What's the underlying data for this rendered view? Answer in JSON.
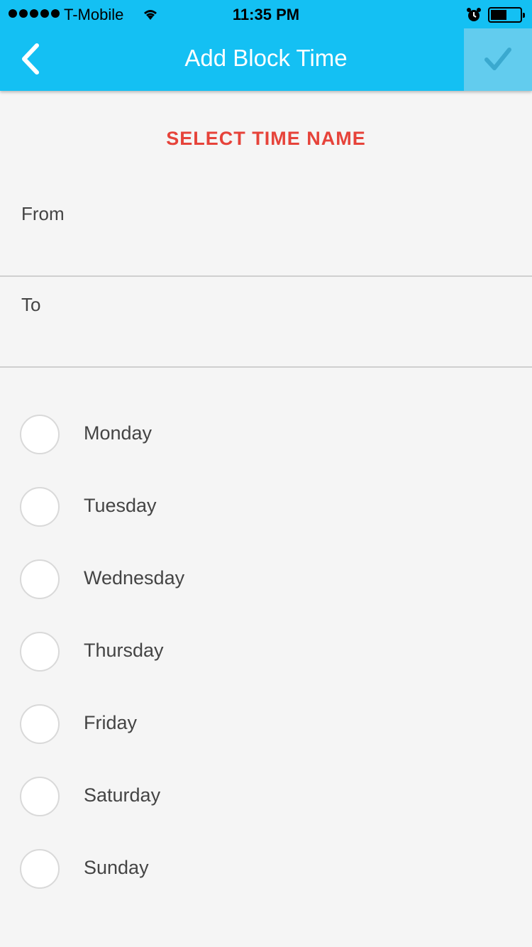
{
  "status_bar": {
    "carrier": "T-Mobile",
    "time": "11:35 PM"
  },
  "header": {
    "title": "Add Block Time",
    "back_icon": "chevron-left-icon",
    "done_icon": "checkmark-icon",
    "background": "#14c0f3"
  },
  "form": {
    "section_title": "SELECT TIME NAME",
    "from_label": "From",
    "to_label": "To"
  },
  "days": [
    {
      "label": "Monday",
      "selected": false
    },
    {
      "label": "Tuesday",
      "selected": false
    },
    {
      "label": "Wednesday",
      "selected": false
    },
    {
      "label": "Thursday",
      "selected": false
    },
    {
      "label": "Friday",
      "selected": false
    },
    {
      "label": "Saturday",
      "selected": false
    },
    {
      "label": "Sunday",
      "selected": false
    }
  ],
  "colors": {
    "accent": "#14c0f3",
    "section_title": "#e6433a",
    "background": "#f5f5f5"
  }
}
